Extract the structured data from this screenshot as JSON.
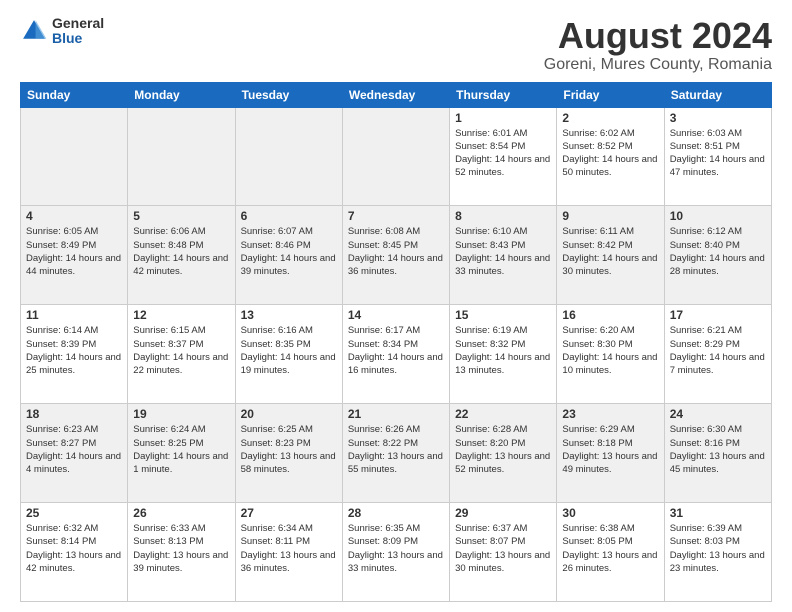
{
  "logo": {
    "general": "General",
    "blue": "Blue"
  },
  "title": "August 2024",
  "subtitle": "Goreni, Mures County, Romania",
  "weekdays": [
    "Sunday",
    "Monday",
    "Tuesday",
    "Wednesday",
    "Thursday",
    "Friday",
    "Saturday"
  ],
  "weeks": [
    [
      {
        "day": "",
        "empty": true
      },
      {
        "day": "",
        "empty": true
      },
      {
        "day": "",
        "empty": true
      },
      {
        "day": "",
        "empty": true
      },
      {
        "day": "1",
        "sunrise": "6:01 AM",
        "sunset": "8:54 PM",
        "daylight": "14 hours and 52 minutes."
      },
      {
        "day": "2",
        "sunrise": "6:02 AM",
        "sunset": "8:52 PM",
        "daylight": "14 hours and 50 minutes."
      },
      {
        "day": "3",
        "sunrise": "6:03 AM",
        "sunset": "8:51 PM",
        "daylight": "14 hours and 47 minutes."
      }
    ],
    [
      {
        "day": "4",
        "sunrise": "6:05 AM",
        "sunset": "8:49 PM",
        "daylight": "14 hours and 44 minutes."
      },
      {
        "day": "5",
        "sunrise": "6:06 AM",
        "sunset": "8:48 PM",
        "daylight": "14 hours and 42 minutes."
      },
      {
        "day": "6",
        "sunrise": "6:07 AM",
        "sunset": "8:46 PM",
        "daylight": "14 hours and 39 minutes."
      },
      {
        "day": "7",
        "sunrise": "6:08 AM",
        "sunset": "8:45 PM",
        "daylight": "14 hours and 36 minutes."
      },
      {
        "day": "8",
        "sunrise": "6:10 AM",
        "sunset": "8:43 PM",
        "daylight": "14 hours and 33 minutes."
      },
      {
        "day": "9",
        "sunrise": "6:11 AM",
        "sunset": "8:42 PM",
        "daylight": "14 hours and 30 minutes."
      },
      {
        "day": "10",
        "sunrise": "6:12 AM",
        "sunset": "8:40 PM",
        "daylight": "14 hours and 28 minutes."
      }
    ],
    [
      {
        "day": "11",
        "sunrise": "6:14 AM",
        "sunset": "8:39 PM",
        "daylight": "14 hours and 25 minutes."
      },
      {
        "day": "12",
        "sunrise": "6:15 AM",
        "sunset": "8:37 PM",
        "daylight": "14 hours and 22 minutes."
      },
      {
        "day": "13",
        "sunrise": "6:16 AM",
        "sunset": "8:35 PM",
        "daylight": "14 hours and 19 minutes."
      },
      {
        "day": "14",
        "sunrise": "6:17 AM",
        "sunset": "8:34 PM",
        "daylight": "14 hours and 16 minutes."
      },
      {
        "day": "15",
        "sunrise": "6:19 AM",
        "sunset": "8:32 PM",
        "daylight": "14 hours and 13 minutes."
      },
      {
        "day": "16",
        "sunrise": "6:20 AM",
        "sunset": "8:30 PM",
        "daylight": "14 hours and 10 minutes."
      },
      {
        "day": "17",
        "sunrise": "6:21 AM",
        "sunset": "8:29 PM",
        "daylight": "14 hours and 7 minutes."
      }
    ],
    [
      {
        "day": "18",
        "sunrise": "6:23 AM",
        "sunset": "8:27 PM",
        "daylight": "14 hours and 4 minutes."
      },
      {
        "day": "19",
        "sunrise": "6:24 AM",
        "sunset": "8:25 PM",
        "daylight": "14 hours and 1 minute."
      },
      {
        "day": "20",
        "sunrise": "6:25 AM",
        "sunset": "8:23 PM",
        "daylight": "13 hours and 58 minutes."
      },
      {
        "day": "21",
        "sunrise": "6:26 AM",
        "sunset": "8:22 PM",
        "daylight": "13 hours and 55 minutes."
      },
      {
        "day": "22",
        "sunrise": "6:28 AM",
        "sunset": "8:20 PM",
        "daylight": "13 hours and 52 minutes."
      },
      {
        "day": "23",
        "sunrise": "6:29 AM",
        "sunset": "8:18 PM",
        "daylight": "13 hours and 49 minutes."
      },
      {
        "day": "24",
        "sunrise": "6:30 AM",
        "sunset": "8:16 PM",
        "daylight": "13 hours and 45 minutes."
      }
    ],
    [
      {
        "day": "25",
        "sunrise": "6:32 AM",
        "sunset": "8:14 PM",
        "daylight": "13 hours and 42 minutes."
      },
      {
        "day": "26",
        "sunrise": "6:33 AM",
        "sunset": "8:13 PM",
        "daylight": "13 hours and 39 minutes."
      },
      {
        "day": "27",
        "sunrise": "6:34 AM",
        "sunset": "8:11 PM",
        "daylight": "13 hours and 36 minutes."
      },
      {
        "day": "28",
        "sunrise": "6:35 AM",
        "sunset": "8:09 PM",
        "daylight": "13 hours and 33 minutes."
      },
      {
        "day": "29",
        "sunrise": "6:37 AM",
        "sunset": "8:07 PM",
        "daylight": "13 hours and 30 minutes."
      },
      {
        "day": "30",
        "sunrise": "6:38 AM",
        "sunset": "8:05 PM",
        "daylight": "13 hours and 26 minutes."
      },
      {
        "day": "31",
        "sunrise": "6:39 AM",
        "sunset": "8:03 PM",
        "daylight": "13 hours and 23 minutes."
      }
    ]
  ]
}
